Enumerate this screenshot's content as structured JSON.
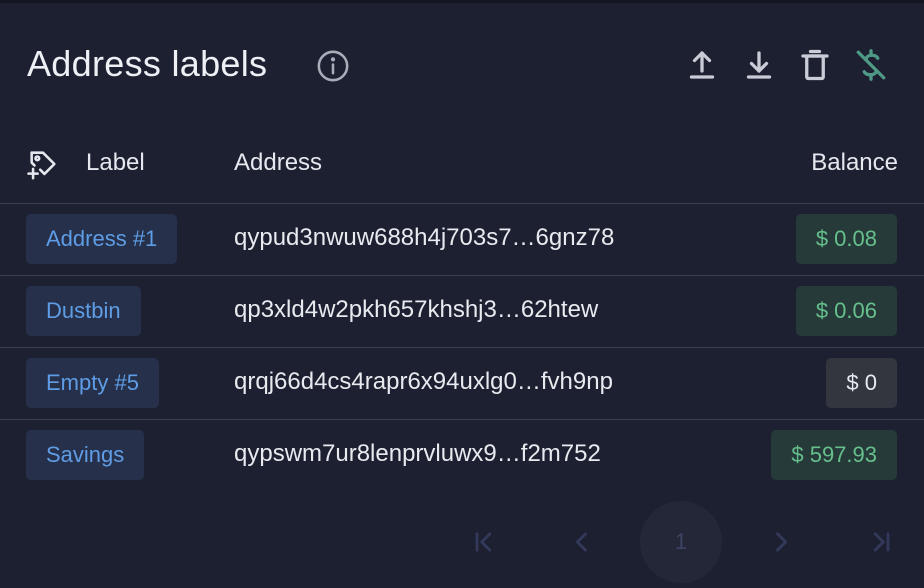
{
  "header": {
    "title": "Address labels"
  },
  "icons": {
    "info": "info-icon",
    "upload": "upload-icon",
    "download": "download-icon",
    "delete": "trash-icon",
    "fiat": "dollar-off-icon",
    "add_tag": "tag-add-icon"
  },
  "table": {
    "columns": {
      "label": "Label",
      "address": "Address",
      "balance": "Balance"
    },
    "rows": [
      {
        "label": "Address #1",
        "address": "qypud3nwuw688h4j703s7…6gnz78",
        "balance": "$ 0.08"
      },
      {
        "label": "Dustbin",
        "address": "qp3xld4w2pkh657khshj3…62htew",
        "balance": "$ 0.06"
      },
      {
        "label": "Empty #5",
        "address": "qrqj66d4cs4rapr6x94uxlg0…fvh9np",
        "balance": "$ 0"
      },
      {
        "label": "Savings",
        "address": "qypswm7ur8lenprvluwx9…f2m752",
        "balance": "$ 597.93"
      }
    ]
  },
  "pagination": {
    "current_page": "1"
  },
  "colors": {
    "background": "#1d2030",
    "label_chip_bg": "#26304a",
    "label_text": "#5e9de6",
    "balance_positive_bg": "#263a3a",
    "balance_positive_text": "#66c08c",
    "balance_zero_bg": "#33363f",
    "fiat_icon": "#4f9a86",
    "pager_icon": "#33395a"
  }
}
